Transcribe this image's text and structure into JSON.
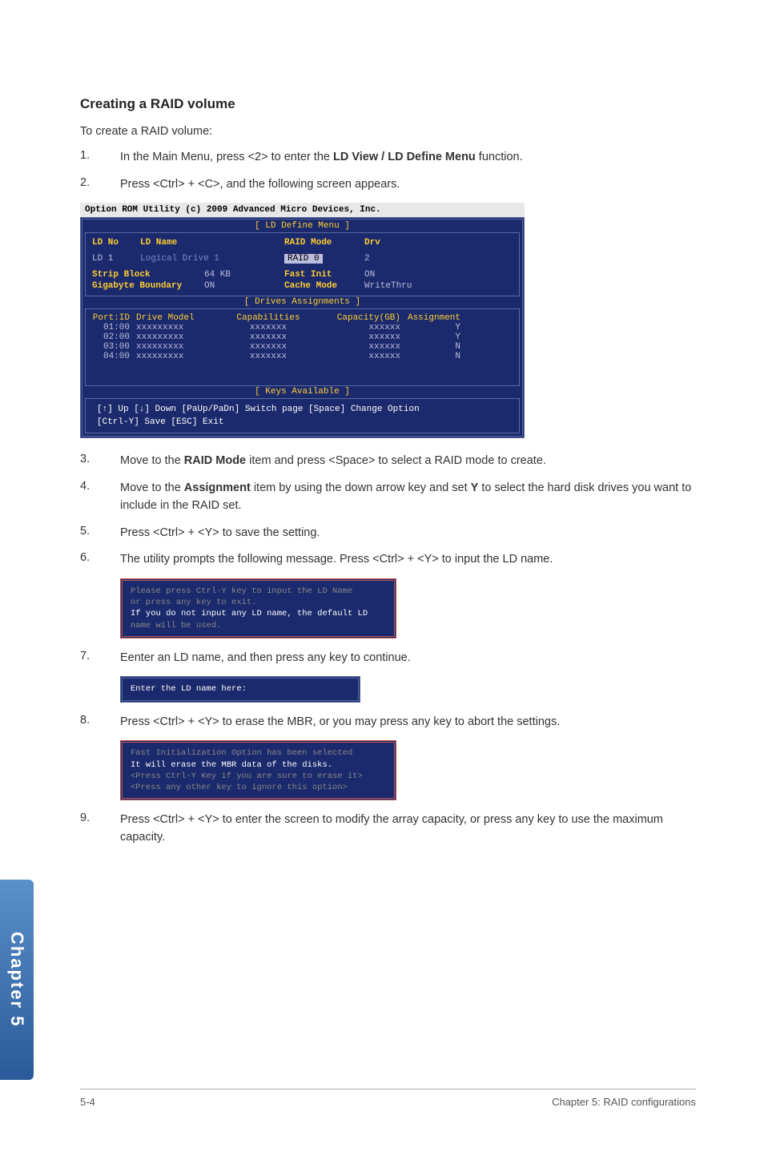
{
  "section_title": "Creating a RAID volume",
  "intro": "To create a RAID volume:",
  "step1": {
    "num": "1.",
    "t1": "In the Main Menu, press <2> to enter the ",
    "bold": "LD View / LD Define Menu",
    "t2": " function."
  },
  "step2": {
    "num": "2.",
    "text": "Press <Ctrl> + <C>, and the following screen appears."
  },
  "bios": {
    "titlebar": "Option ROM Utility (c) 2009 Advanced Micro Devices, Inc.",
    "define_label": "[ LD Define Menu ]",
    "ldno_label": "LD No",
    "ldname_label": "LD Name",
    "raidmode_label": "RAID Mode",
    "drv_label": "Drv",
    "ld_row": {
      "no": "LD  1",
      "name": "Logical Drive 1",
      "raid_sel": " RAID 0 ",
      "drv": "2"
    },
    "strip_label": "Strip Block",
    "strip_val": "64 KB",
    "fastinit_label": "Fast Init",
    "fastinit_val": "ON",
    "gig_label": "Gigabyte Boundary",
    "gig_val": "ON",
    "cache_label": "Cache Mode",
    "cache_val": "WriteThru",
    "drives_label": "[ Drives Assignments ]",
    "drive_headers": {
      "port": "Port:ID",
      "model": "Drive Model",
      "cap": "Capabilities",
      "gb": "Capacity(GB)",
      "asn": "Assignment"
    },
    "drives": [
      {
        "port": "01:00",
        "model": "xxxxxxxxx",
        "cap": "xxxxxxx",
        "gb": "xxxxxx",
        "asn": "Y"
      },
      {
        "port": "02:00",
        "model": "xxxxxxxxx",
        "cap": "xxxxxxx",
        "gb": "xxxxxx",
        "asn": "Y"
      },
      {
        "port": "03:00",
        "model": "xxxxxxxxx",
        "cap": "xxxxxxx",
        "gb": "xxxxxx",
        "asn": "N"
      },
      {
        "port": "04:00",
        "model": "xxxxxxxxx",
        "cap": "xxxxxxx",
        "gb": "xxxxxx",
        "asn": "N"
      }
    ],
    "keys_label": "[ Keys Available ]",
    "keys1": "[↑] Up  [↓] Down  [PaUp/PaDn] Switch page  [Space] Change Option",
    "keys2": "[Ctrl-Y] Save  [ESC] Exit"
  },
  "step3": {
    "num": "3.",
    "t1": "Move to the ",
    "bold": "RAID Mode",
    "t2": " item and press <Space> to select a RAID mode to create."
  },
  "step4": {
    "num": "4.",
    "t1": "Move to the ",
    "bold": "Assignment",
    "t2": " item by using the down arrow key and set ",
    "bold2": "Y",
    "t3": " to select the hard disk drives you want to include in the RAID set."
  },
  "step5": {
    "num": "5.",
    "text": "Press <Ctrl> + <Y> to save the setting."
  },
  "step6": {
    "num": "6.",
    "text": "The utility prompts the following message. Press <Ctrl> + <Y> to input the LD name."
  },
  "dlg1": {
    "l1": "Please press Ctrl-Y key to input the LD Name",
    "l2": "or press any key to exit.",
    "l3": "If you do not input any LD name, the default LD",
    "l4": "name will be used."
  },
  "step7": {
    "num": "7.",
    "text": "Eenter an LD name, and then press any key to continue."
  },
  "dlg2": {
    "l1": "Enter the LD name here:"
  },
  "step8": {
    "num": "8.",
    "text": "Press <Ctrl> + <Y> to erase the MBR, or you may press any key to abort the settings."
  },
  "dlg3": {
    "l1": "Fast Initialization Option has been selected",
    "l2": "It will erase the MBR data of the disks.",
    "l3": "<Press Ctrl-Y Key if you are sure to erase it>",
    "l4": "<Press any other key to ignore this option>"
  },
  "step9": {
    "num": "9.",
    "text": "Press <Ctrl> + <Y> to enter the screen to modify the array capacity, or press any key to use the maximum capacity."
  },
  "sidetab": "Chapter 5",
  "footer": {
    "left": "5-4",
    "right": "Chapter 5: RAID configurations"
  }
}
